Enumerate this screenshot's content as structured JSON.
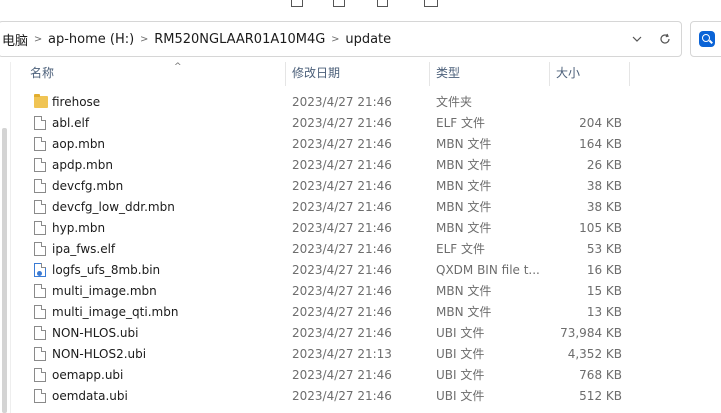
{
  "address": {
    "crumbs": [
      "电脑",
      "ap-home (H:)",
      "RM520NGLAAR01A10M4G",
      "update"
    ],
    "dropdown_icon": "chevron-down-icon",
    "refresh_icon": "refresh-icon"
  },
  "search": {
    "icon": "search-icon",
    "accent": "#0a63d6"
  },
  "columns": {
    "name": "名称",
    "date": "修改日期",
    "type": "类型",
    "size": "大小"
  },
  "files": [
    {
      "icon": "folder-icon",
      "name": "firehose",
      "date": "2023/4/27 21:46",
      "type": "文件夹",
      "size": ""
    },
    {
      "icon": "file-icon",
      "name": "abl.elf",
      "date": "2023/4/27 21:46",
      "type": "ELF 文件",
      "size": "204 KB"
    },
    {
      "icon": "file-icon",
      "name": "aop.mbn",
      "date": "2023/4/27 21:46",
      "type": "MBN 文件",
      "size": "164 KB"
    },
    {
      "icon": "file-icon",
      "name": "apdp.mbn",
      "date": "2023/4/27 21:46",
      "type": "MBN 文件",
      "size": "26 KB"
    },
    {
      "icon": "file-icon",
      "name": "devcfg.mbn",
      "date": "2023/4/27 21:46",
      "type": "MBN 文件",
      "size": "38 KB"
    },
    {
      "icon": "file-icon",
      "name": "devcfg_low_ddr.mbn",
      "date": "2023/4/27 21:46",
      "type": "MBN 文件",
      "size": "38 KB"
    },
    {
      "icon": "file-icon",
      "name": "hyp.mbn",
      "date": "2023/4/27 21:46",
      "type": "MBN 文件",
      "size": "105 KB"
    },
    {
      "icon": "file-icon",
      "name": "ipa_fws.elf",
      "date": "2023/4/27 21:46",
      "type": "ELF 文件",
      "size": "53 KB"
    },
    {
      "icon": "qxdm-file-icon",
      "name": "logfs_ufs_8mb.bin",
      "date": "2023/4/27 21:46",
      "type": "QXDM BIN file t...",
      "size": "16 KB"
    },
    {
      "icon": "file-icon",
      "name": "multi_image.mbn",
      "date": "2023/4/27 21:46",
      "type": "MBN 文件",
      "size": "15 KB"
    },
    {
      "icon": "file-icon",
      "name": "multi_image_qti.mbn",
      "date": "2023/4/27 21:46",
      "type": "MBN 文件",
      "size": "13 KB"
    },
    {
      "icon": "file-icon",
      "name": "NON-HLOS.ubi",
      "date": "2023/4/27 21:46",
      "type": "UBI 文件",
      "size": "73,984 KB"
    },
    {
      "icon": "file-icon",
      "name": "NON-HLOS2.ubi",
      "date": "2023/4/27 21:13",
      "type": "UBI 文件",
      "size": "4,352 KB"
    },
    {
      "icon": "file-icon",
      "name": "oemapp.ubi",
      "date": "2023/4/27 21:46",
      "type": "UBI 文件",
      "size": "768 KB"
    },
    {
      "icon": "file-icon",
      "name": "oemdata.ubi",
      "date": "2023/4/27 21:46",
      "type": "UBI 文件",
      "size": "512 KB"
    }
  ]
}
